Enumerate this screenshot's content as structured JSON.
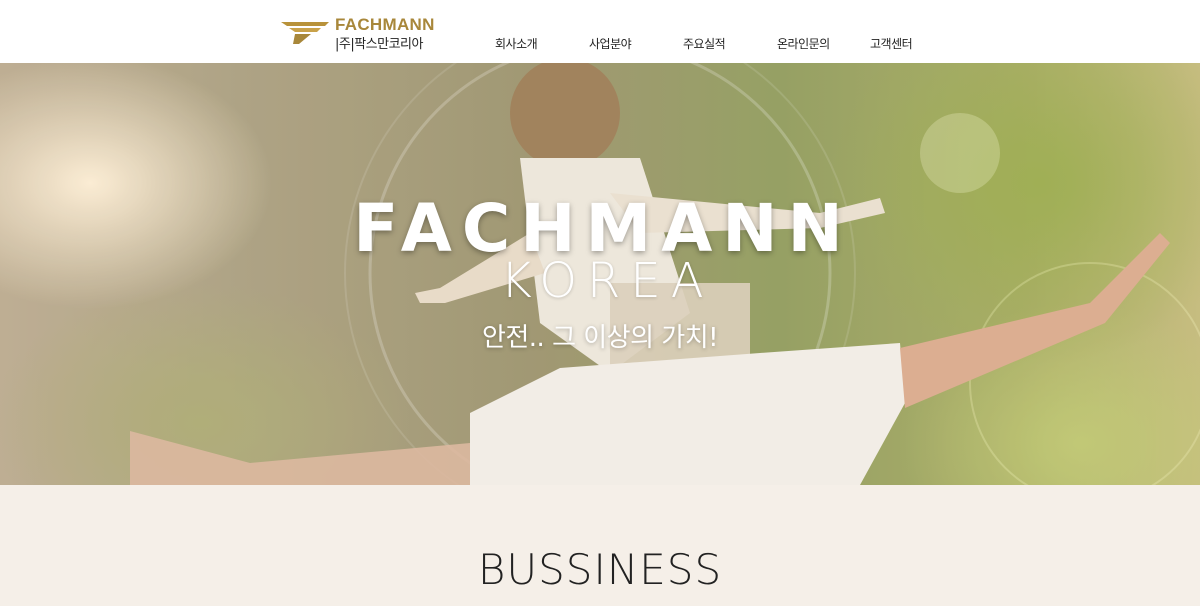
{
  "header": {
    "logo": {
      "name": "FACHMANN",
      "sub": "|주|팍스만코리아"
    },
    "nav": [
      {
        "label": "회사소개"
      },
      {
        "label": "사업분야"
      },
      {
        "label": "주요실적"
      },
      {
        "label": "온라인문의"
      },
      {
        "label": "고객센터"
      }
    ]
  },
  "hero": {
    "title": "FACHMANN",
    "subtitle": "KOREA",
    "tagline": "안전.. 그 이상의 가치!"
  },
  "business": {
    "title": "BUSSINESS"
  },
  "colors": {
    "brand_gold": "#a8873a",
    "section_bg": "#f5efe8",
    "header_bg": "#ffffff"
  }
}
